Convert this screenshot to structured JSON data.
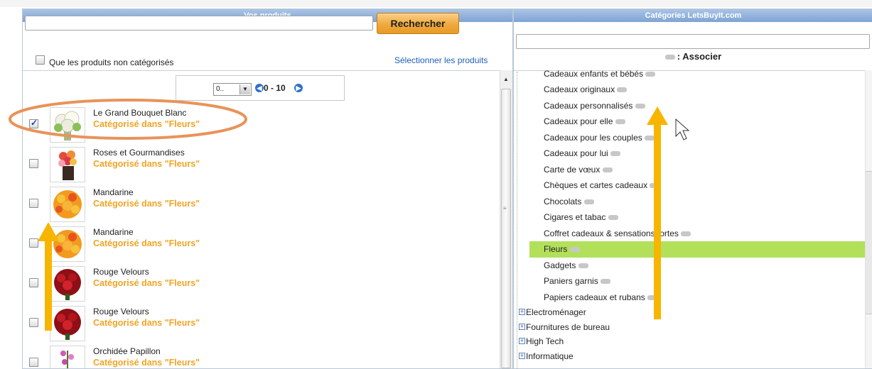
{
  "left_panel": {
    "title": "Vos produits",
    "search_value": "",
    "search_button": "Rechercher",
    "filter_label": "Que les produits non catégorisés",
    "select_link": "Sélectionner les produits",
    "pager": {
      "select_value": "0..",
      "range": "0 - 10"
    },
    "products": [
      {
        "name": "Le Grand Bouquet Blanc",
        "category": "Catégorisé dans \"Fleurs\"",
        "checked": true
      },
      {
        "name": "Roses et Gourmandises",
        "category": "Catégorisé dans \"Fleurs\"",
        "checked": false
      },
      {
        "name": "Mandarine",
        "category": "Catégorisé dans \"Fleurs\"",
        "checked": false
      },
      {
        "name": "Mandarine",
        "category": "Catégorisé dans \"Fleurs\"",
        "checked": false
      },
      {
        "name": "Rouge Velours",
        "category": "Catégorisé dans \"Fleurs\"",
        "checked": false
      },
      {
        "name": "Rouge Velours",
        "category": "Catégorisé dans \"Fleurs\"",
        "checked": false
      },
      {
        "name": "Orchidée Papillon",
        "category": "Catégorisé dans \"Fleurs\"",
        "checked": false
      }
    ]
  },
  "right_panel": {
    "title": "Catégories LetsBuyIt.com",
    "search_value": "",
    "associer_label": ": Associer",
    "categories": [
      "Cadeaux enfants et bébés",
      "Cadeaux originaux",
      "Cadeaux personnalisés",
      "Cadeaux pour elle",
      "Cadeaux pour les couples",
      "Cadeaux pour lui",
      "Carte de vœux",
      "Chèques et cartes cadeaux",
      "Chocolats",
      "Cigares et tabac",
      "Coffret cadeaux & sensations fortes",
      "Fleurs",
      "Gadgets",
      "Paniers garnis",
      "Papiers cadeaux et rubans"
    ],
    "selected_category": "Fleurs",
    "groups": [
      "Electroménager",
      "Fournitures de bureau",
      "High Tech",
      "Informatique"
    ]
  },
  "colors": {
    "header_blue": "#8aaddb",
    "accent_orange": "#f2a425",
    "selected_green": "#b2e05b",
    "annotation_orange": "#e8935a",
    "arrow_yellow": "#f7b500"
  },
  "icons": [
    "check-icon",
    "dropdown-arrow-icon",
    "prev-page-icon",
    "next-page-icon",
    "associate-pill-icon",
    "expand-plus-icon",
    "mouse-cursor-icon"
  ]
}
